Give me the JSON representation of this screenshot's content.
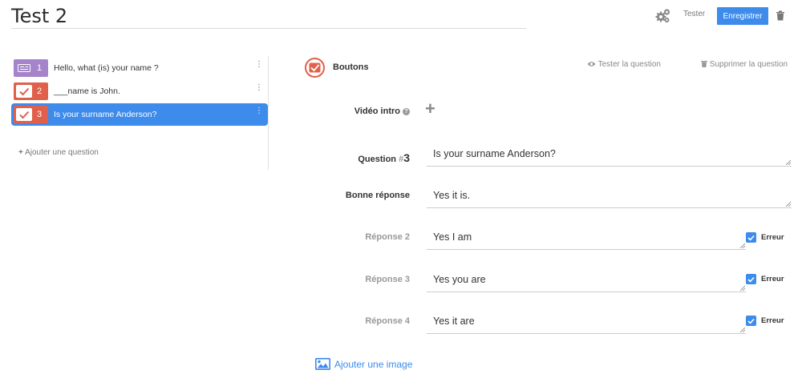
{
  "header": {
    "title": "Test 2",
    "tester_label": "Tester",
    "save_label": "Enregistrer"
  },
  "sidebar": {
    "questions": [
      {
        "number": "1",
        "text": "Hello, what (is) your name ?",
        "type_icon": "fill-blank-icon",
        "badge_color": "#a584c9"
      },
      {
        "number": "2",
        "text": "___name is John.",
        "type_icon": "buttons-check-icon",
        "badge_color": "#e0604c"
      },
      {
        "number": "3",
        "text": "Is your surname Anderson?",
        "type_icon": "buttons-check-icon",
        "badge_color": "#e0604c",
        "active": true
      }
    ],
    "add_question": "Ajouter une question"
  },
  "editor": {
    "type_label": "Boutons",
    "test_question": "Tester la question",
    "delete_question": "Supprimer la question",
    "video_intro_label": "Vidéo intro",
    "question_label": "Question",
    "question_hash": "#",
    "question_number": "3",
    "question_text": "Is your surname Anderson?",
    "good_answer_label": "Bonne réponse",
    "good_answer": "Yes it is.",
    "responses": [
      {
        "label": "Réponse 2",
        "value": "Yes I am",
        "error_label": "Erreur",
        "error_checked": true
      },
      {
        "label": "Réponse 3",
        "value": "Yes you are",
        "error_label": "Erreur",
        "error_checked": true
      },
      {
        "label": "Réponse 4",
        "value": "Yes it are",
        "error_label": "Erreur",
        "error_checked": true
      }
    ],
    "add_image": "Ajouter une image"
  },
  "colors": {
    "accent": "#3d8bea",
    "buttons_type": "#e0604c",
    "fill_type": "#a584c9"
  }
}
